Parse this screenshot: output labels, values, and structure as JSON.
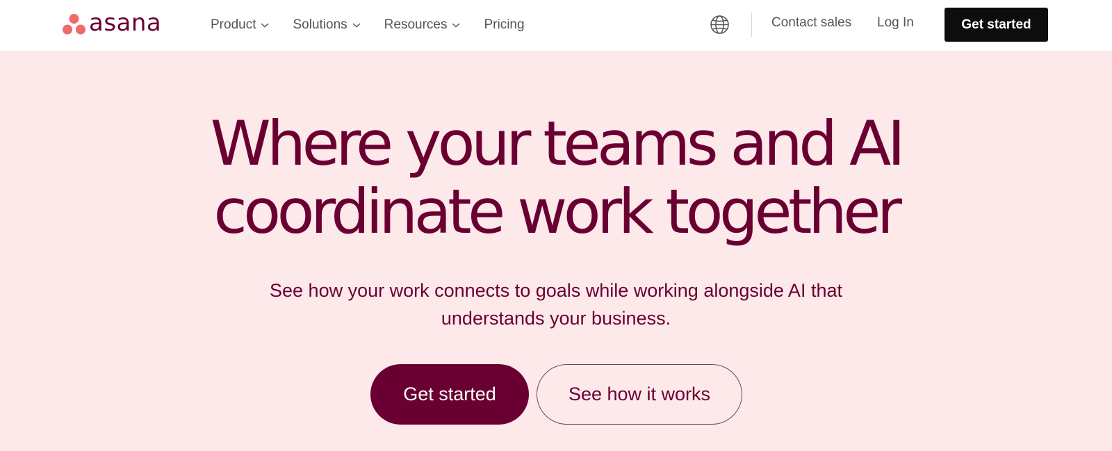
{
  "brand": {
    "name": "asana",
    "logo_icon": "asana-dots-logo",
    "dot_color": "#f06a6a",
    "word_color": "#690031"
  },
  "nav": {
    "items": [
      {
        "label": "Product",
        "icon": "chevron-down-icon"
      },
      {
        "label": "Solutions",
        "icon": "chevron-down-icon"
      },
      {
        "label": "Resources",
        "icon": "chevron-down-icon"
      },
      {
        "label": "Pricing"
      }
    ],
    "language_icon": "globe-icon",
    "contact_label": "Contact sales",
    "login_label": "Log In",
    "cta_label": "Get started"
  },
  "hero": {
    "title_line1": "Where your teams and AI",
    "title_line2": "coordinate work together",
    "subtitle_line1": "See how your work connects to goals while working alongside AI that",
    "subtitle_line2": "understands your business.",
    "primary_cta": "Get started",
    "secondary_cta": "See how it works"
  },
  "colors": {
    "hero_background": "#fde8ea",
    "header_background": "#ffffff",
    "primary": "#690031",
    "header_cta_background": "#0d0d0d"
  }
}
